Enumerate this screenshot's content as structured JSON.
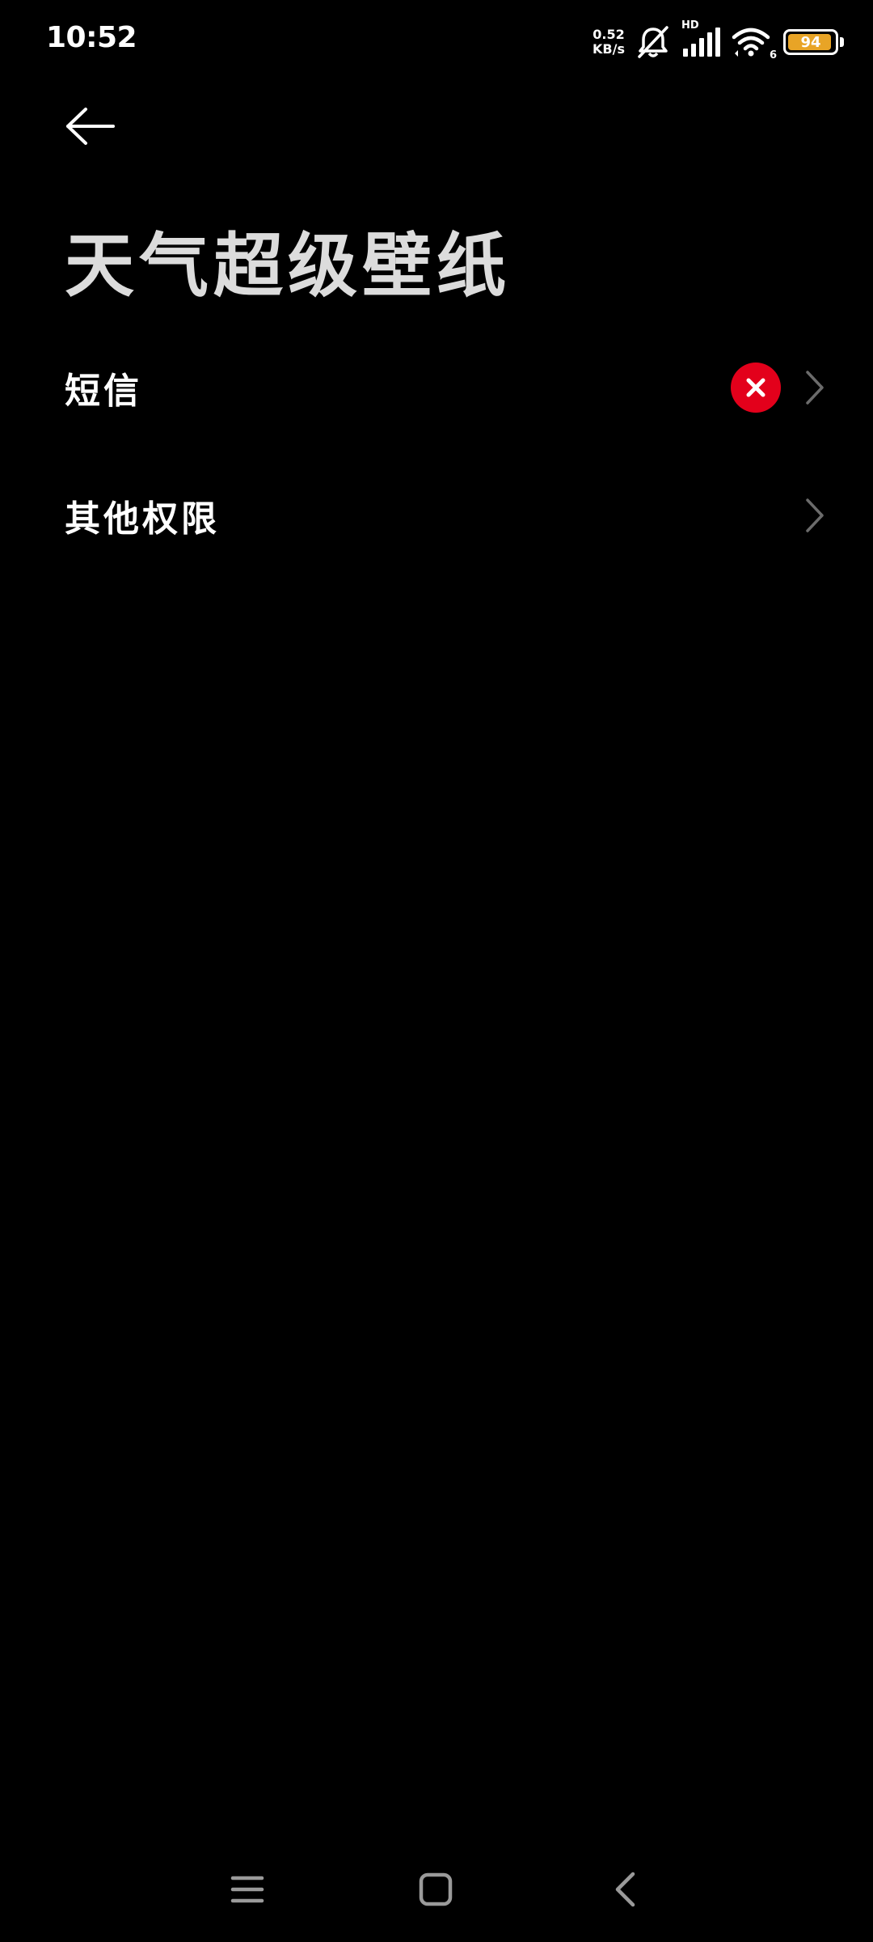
{
  "status_bar": {
    "time": "10:52",
    "net_speed_value": "0.52",
    "net_speed_unit": "KB/s",
    "signal_label": "HD",
    "wifi_label": "6",
    "battery_level": "94",
    "battery_fraction": 0.94,
    "icons": [
      "bell-off-icon",
      "cell-signal-icon",
      "wifi-icon",
      "battery-icon"
    ]
  },
  "header": {
    "back_icon": "arrow-left-icon",
    "title": "天气超级壁纸"
  },
  "permissions": [
    {
      "label": "短信",
      "status": "denied",
      "status_icon": "close-circle-icon",
      "chevron": "chevron-right-icon"
    },
    {
      "label": "其他权限",
      "chevron": "chevron-right-icon"
    }
  ],
  "nav_bar": {
    "icons": [
      "menu-icon",
      "home-icon",
      "back-icon"
    ]
  },
  "colors": {
    "background": "#000000",
    "title": "#dcdcdc",
    "text": "#ffffff",
    "deny_badge": "#e3001b",
    "chevron": "#6b6b6b",
    "battery_fill": "#e8a426",
    "nav_icon": "#9a9a9a"
  }
}
